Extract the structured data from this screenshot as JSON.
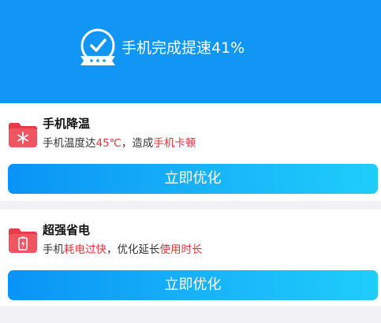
{
  "header": {
    "title": "手机完成提速41%",
    "badge_icon": "check-ribbon-badge-icon",
    "background": "#1196f5"
  },
  "cards": [
    {
      "icon": "folder-snowflake-icon",
      "title": "手机降温",
      "desc_parts": [
        "手机温度达",
        "45℃",
        "，造成",
        "手机卡顿"
      ],
      "button_label": "立即优化"
    },
    {
      "icon": "folder-battery-icon",
      "title": "超强省电",
      "desc_parts": [
        "手机",
        "耗电过快",
        "，优化延长",
        "使用时长"
      ],
      "button_label": "立即优化"
    }
  ],
  "colors": {
    "highlight": "#e8303a",
    "button_start": "#0a94f6",
    "button_end": "#1ecdfb"
  }
}
